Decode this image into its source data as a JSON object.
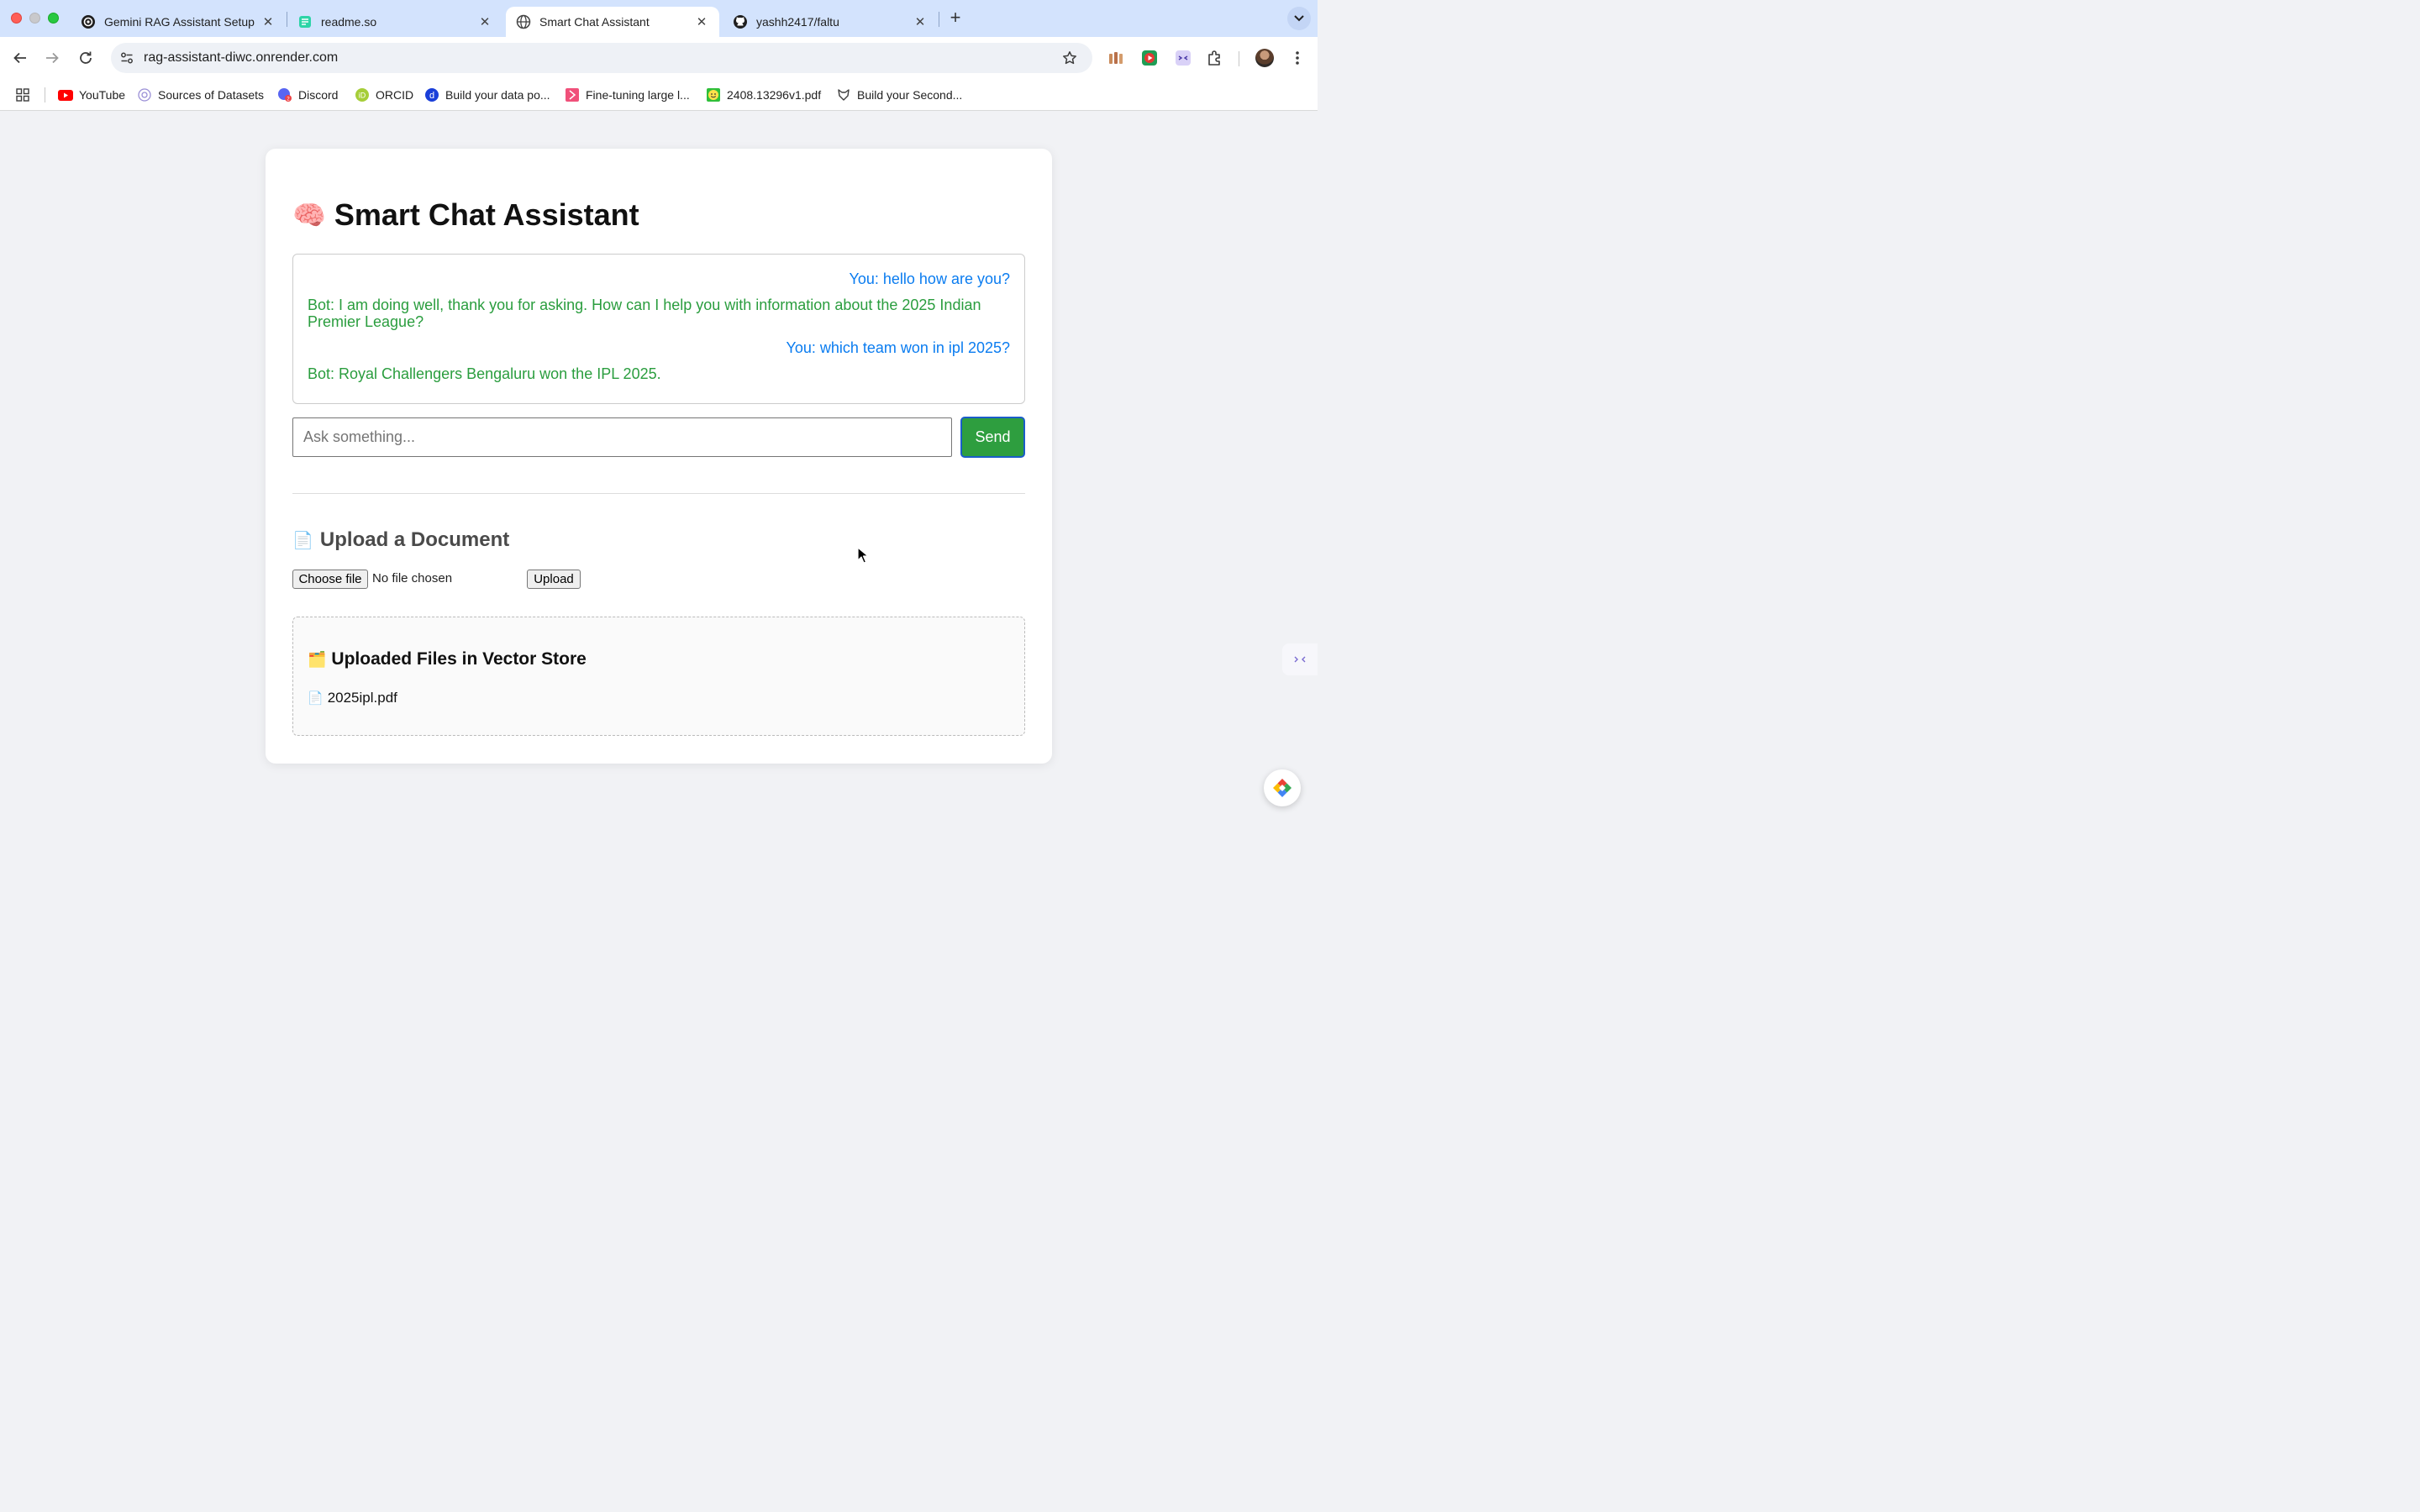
{
  "browser": {
    "tabs": [
      {
        "title": "Gemini RAG Assistant Setup",
        "icon": "openai-icon",
        "active": false
      },
      {
        "title": "readme.so",
        "icon": "readme-icon",
        "active": false
      },
      {
        "title": "Smart Chat Assistant",
        "icon": "globe-icon",
        "active": true
      },
      {
        "title": "yashh2417/faltu",
        "icon": "github-icon",
        "active": false
      }
    ],
    "url": "rag-assistant-diwc.onrender.com",
    "bookmarks": [
      {
        "label": "YouTube",
        "icon": "youtube-icon"
      },
      {
        "label": "Sources of Datasets",
        "icon": "dataset-icon"
      },
      {
        "label": "Discord",
        "icon": "discord-icon"
      },
      {
        "label": "ORCID",
        "icon": "orcid-icon"
      },
      {
        "label": "Build your data po...",
        "icon": "d-icon"
      },
      {
        "label": "Fine-tuning large l...",
        "icon": "bookmark-page-icon"
      },
      {
        "label": "2408.13296v1.pdf",
        "icon": "smiley-icon"
      },
      {
        "label": "Build your Second...",
        "icon": "fox-icon"
      }
    ]
  },
  "page": {
    "title": "Smart Chat Assistant",
    "title_emoji": "🧠",
    "chat": {
      "messages": [
        {
          "role": "user",
          "text": "You: hello how are you?"
        },
        {
          "role": "bot",
          "text": "Bot: I am doing well, thank you for asking. How can I help you with information about the 2025 Indian Premier League?"
        },
        {
          "role": "user",
          "text": "You: which team won in ipl 2025?"
        },
        {
          "role": "bot",
          "text": "Bot: Royal Challengers Bengaluru won the IPL 2025."
        }
      ],
      "input_placeholder": "Ask something...",
      "input_value": "",
      "send_label": "Send"
    },
    "upload": {
      "heading": "Upload a Document",
      "heading_emoji": "📄",
      "choose_label": "Choose file",
      "status": "No file chosen",
      "upload_label": "Upload"
    },
    "vector_store": {
      "heading": "Uploaded Files in Vector Store",
      "heading_emoji": "🗂️",
      "files": [
        {
          "emoji": "📄",
          "name": "2025ipl.pdf"
        }
      ]
    }
  },
  "colors": {
    "user_message": "#0a7cf0",
    "bot_message": "#2a9d3e",
    "send_button": "#2e9e3f",
    "tab_strip": "#d3e3fd"
  }
}
